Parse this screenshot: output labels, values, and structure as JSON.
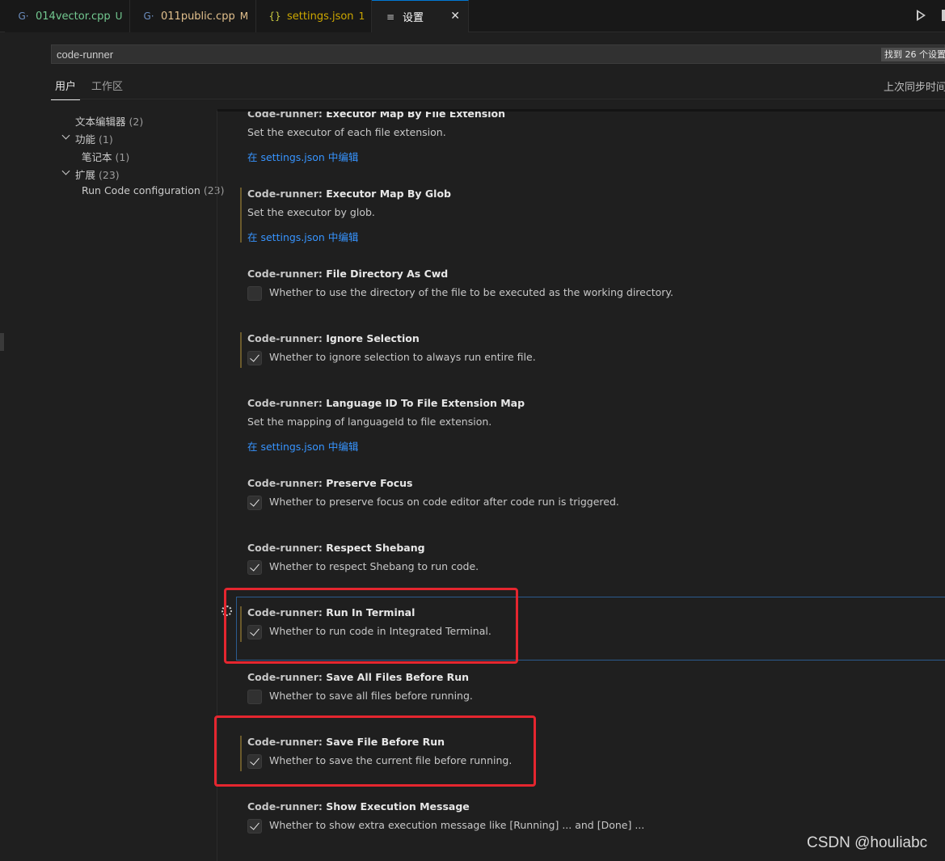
{
  "tabs": [
    {
      "icon": "G·",
      "name": "014vector.cpp",
      "status": "U",
      "name_color": "#73c991",
      "status_color": "#73c991",
      "icon_color": "#6c8ebf"
    },
    {
      "icon": "G·",
      "name": "011public.cpp",
      "status": "M",
      "name_color": "#e2c08d",
      "status_color": "#e2c08d",
      "icon_color": "#6c8ebf"
    },
    {
      "icon": "{}",
      "name": "settings.json",
      "status": "1",
      "name_color": "#cca700",
      "status_color": "#cca700",
      "icon_color": "#cbcb41"
    },
    {
      "icon": "≡",
      "name": "设置",
      "close": "✕",
      "name_color": "#ffffff",
      "icon_color": "#cccccc"
    }
  ],
  "search": {
    "value": "code-runner",
    "result_count": "找到 26 个设置"
  },
  "scopes": {
    "user": "用户",
    "workspace": "工作区",
    "sync": "上次同步时间"
  },
  "toc": [
    {
      "label": "文本编辑器",
      "count": "(2)"
    },
    {
      "label": "功能",
      "count": "(1)"
    },
    {
      "label": "笔记本",
      "count": "(1)"
    },
    {
      "label": "扩展",
      "count": "(23)"
    },
    {
      "label": "Run Code configuration",
      "count": "(23)"
    }
  ],
  "settings": [
    {
      "category": "Code-runner: ",
      "name": "Executor Map By File Extension",
      "desc": "Set the executor of each file extension.",
      "link": "在 settings.json 中编辑"
    },
    {
      "category": "Code-runner: ",
      "name": "Executor Map By Glob",
      "desc": "Set the executor by glob.",
      "link": "在 settings.json 中编辑"
    },
    {
      "category": "Code-runner: ",
      "name": "File Directory As Cwd",
      "desc": "Whether to use the directory of the file to be executed as the working directory.",
      "checked": false
    },
    {
      "category": "Code-runner: ",
      "name": "Ignore Selection",
      "desc": "Whether to ignore selection to always run entire file.",
      "checked": true
    },
    {
      "category": "Code-runner: ",
      "name": "Language ID To File Extension Map",
      "desc": "Set the mapping of languageId to file extension.",
      "link": "在 settings.json 中编辑"
    },
    {
      "category": "Code-runner: ",
      "name": "Preserve Focus",
      "desc": "Whether to preserve focus on code editor after code run is triggered.",
      "checked": true
    },
    {
      "category": "Code-runner: ",
      "name": "Respect Shebang",
      "desc": "Whether to respect Shebang to run code.",
      "checked": true
    },
    {
      "category": "Code-runner: ",
      "name": "Run In Terminal",
      "desc": "Whether to run code in Integrated Terminal.",
      "checked": true
    },
    {
      "category": "Code-runner: ",
      "name": "Save All Files Before Run",
      "desc": "Whether to save all files before running.",
      "checked": false
    },
    {
      "category": "Code-runner: ",
      "name": "Save File Before Run",
      "desc": "Whether to save the current file before running.",
      "checked": true
    },
    {
      "category": "Code-runner: ",
      "name": "Show Execution Message",
      "desc": "Whether to show extra execution message like [Running] ... and [Done] ...",
      "checked": true
    }
  ],
  "watermark": "CSDN @houliabc",
  "colors": {
    "accent": "#0078d4",
    "link": "#3794ff",
    "modified_bar": "#6b5a2c",
    "annotation_red": "#e5262f"
  }
}
